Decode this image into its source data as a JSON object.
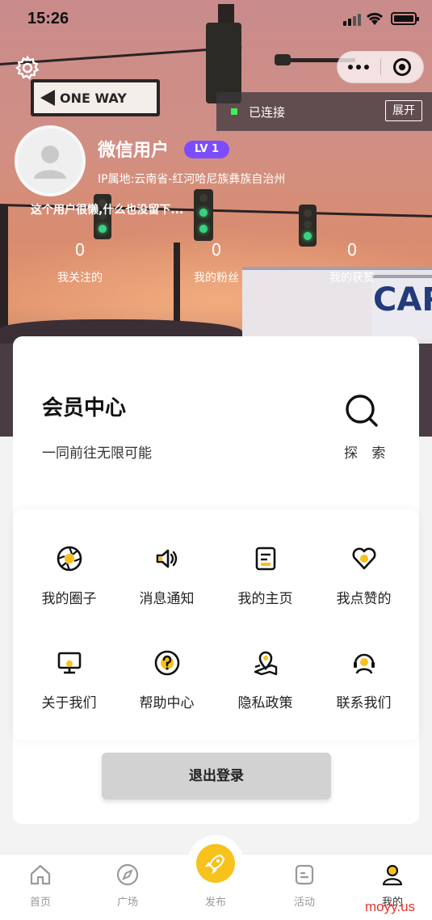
{
  "status_bar": {
    "time": "15:26"
  },
  "capsule": {
    "more_icon": "more-dots-icon",
    "close_icon": "target-icon"
  },
  "connection": {
    "status": "已连接",
    "expand_label": "展开"
  },
  "hero_sign": {
    "text": "ONE WAY"
  },
  "profile": {
    "username": "微信用户",
    "level": "LV 1",
    "ip_location": "IP属地:云南省-红河哈尼族彝族自治州",
    "bio": "这个用户很懒,什么也没留下..."
  },
  "stats": [
    {
      "value": "0",
      "label": "我关注的"
    },
    {
      "value": "0",
      "label": "我的粉丝"
    },
    {
      "value": "0",
      "label": "我的获赞"
    }
  ],
  "member": {
    "title": "会员中心",
    "subtitle": "一同前往无限可能",
    "explore_label": "探 索"
  },
  "menu": [
    {
      "label": "我的圈子",
      "icon": "aperture-icon"
    },
    {
      "label": "消息通知",
      "icon": "speaker-icon"
    },
    {
      "label": "我的主页",
      "icon": "document-icon"
    },
    {
      "label": "我点赞的",
      "icon": "heart-icon"
    },
    {
      "label": "关于我们",
      "icon": "monitor-icon"
    },
    {
      "label": "帮助中心",
      "icon": "question-icon"
    },
    {
      "label": "隐私政策",
      "icon": "map-pin-icon"
    },
    {
      "label": "联系我们",
      "icon": "support-icon"
    }
  ],
  "logout_label": "退出登录",
  "tabbar": [
    {
      "label": "首页",
      "icon": "home-icon"
    },
    {
      "label": "广场",
      "icon": "compass-icon"
    },
    {
      "label": "发布",
      "icon": "rocket-icon"
    },
    {
      "label": "活动",
      "icon": "activity-icon"
    },
    {
      "label": "我的",
      "icon": "user-icon"
    }
  ],
  "watermark": "moyy.us",
  "colors": {
    "accent_yellow": "#f7c21b",
    "level_purple": "#7c4dff",
    "online_green": "#3ef050"
  }
}
